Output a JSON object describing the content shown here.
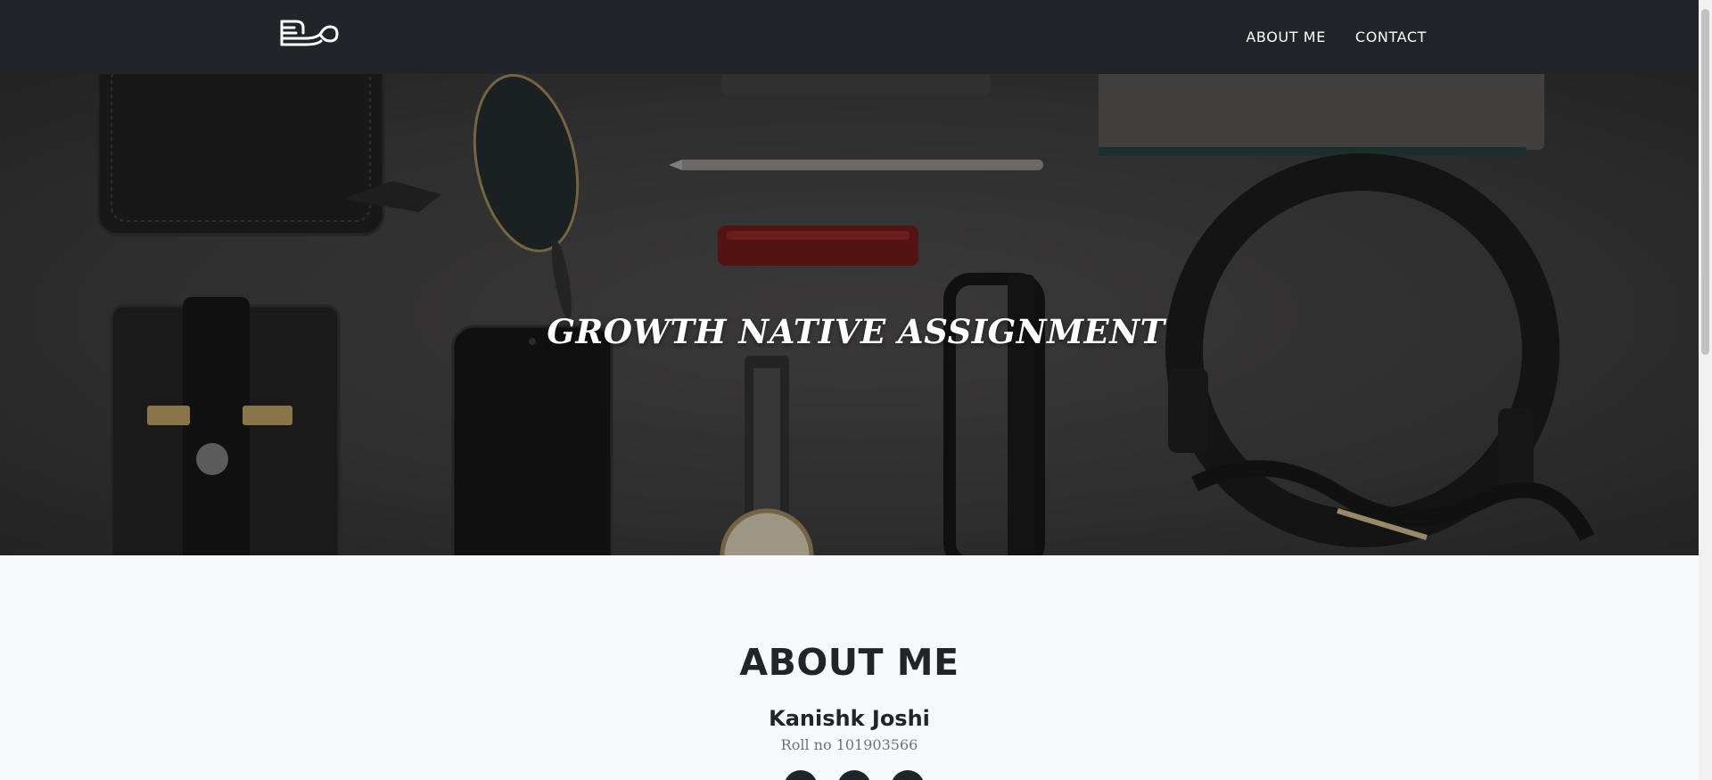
{
  "nav": {
    "logo_icon": "fork-spoon-logo-icon",
    "links": [
      {
        "label": "ABOUT ME"
      },
      {
        "label": "CONTACT"
      }
    ]
  },
  "hero": {
    "title": "GROWTH NATIVE ASSIGNMENT"
  },
  "about": {
    "heading": "ABOUT ME",
    "name": "Kanishk Joshi",
    "roll": "Roll no 101903566",
    "social": [
      {
        "icon": "social-icon-1"
      },
      {
        "icon": "social-icon-2"
      },
      {
        "icon": "social-icon-3"
      }
    ]
  },
  "colors": {
    "navbar": "#212529",
    "page_bg": "#f8f9fa",
    "text_dark": "#212529",
    "text_muted": "#6c757d"
  }
}
